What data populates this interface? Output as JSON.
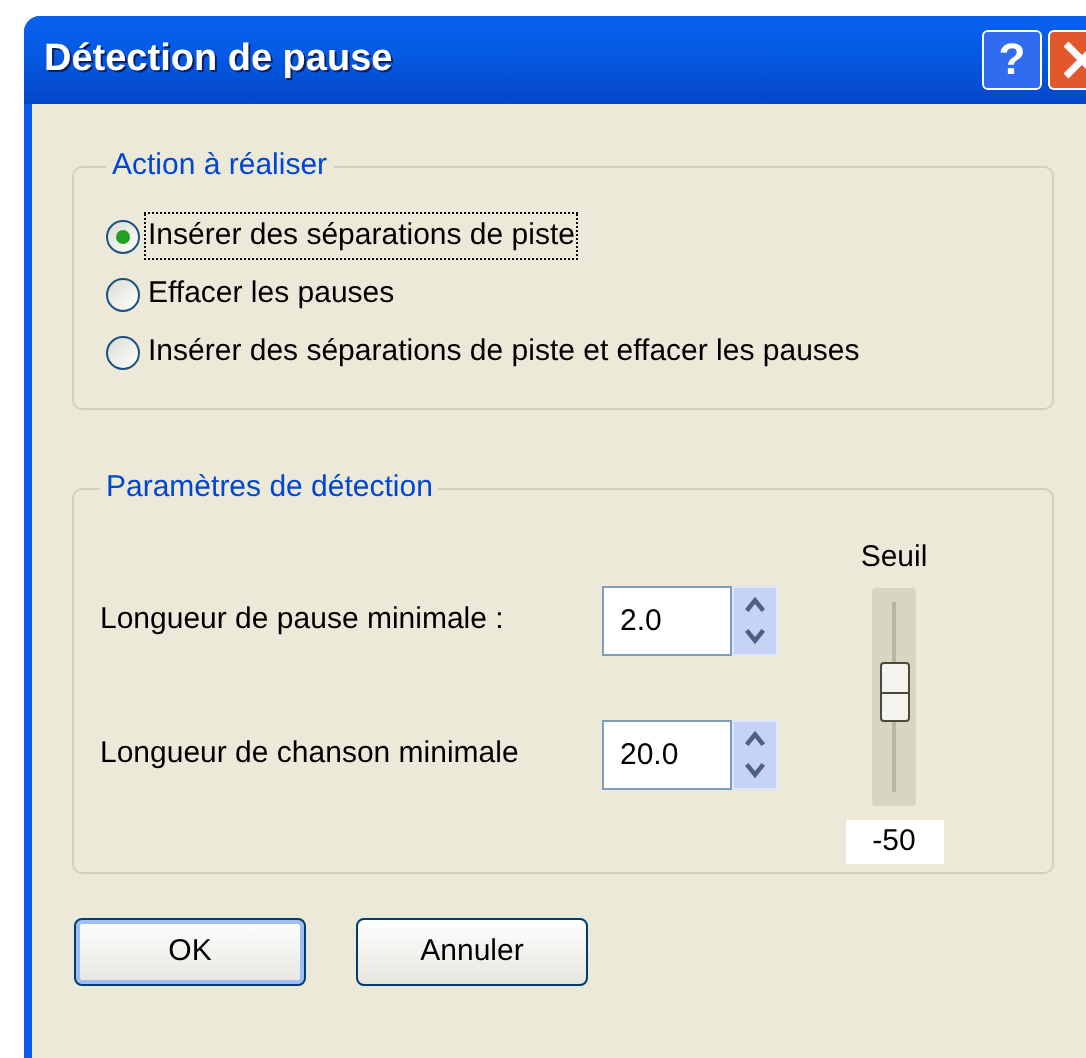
{
  "window": {
    "title": "Détection de pause",
    "help_button": "?"
  },
  "action_group": {
    "title": "Action à réaliser",
    "options": [
      {
        "label": "Insérer des séparations de piste",
        "selected": true
      },
      {
        "label": "Effacer les pauses",
        "selected": false
      },
      {
        "label": "Insérer des séparations de piste et effacer les pauses",
        "selected": false
      }
    ]
  },
  "detection_group": {
    "title": "Paramètres de détection",
    "fields": [
      {
        "label": "Longueur de pause minimale :",
        "value": "2.0"
      },
      {
        "label": "Longueur de chanson minimale",
        "value": "20.0"
      }
    ],
    "threshold": {
      "label": "Seuil",
      "level": 0.53,
      "reading": "-50"
    }
  },
  "buttons": [
    {
      "label": "OK",
      "default": true
    },
    {
      "label": "Annuler",
      "default": false
    }
  ]
}
